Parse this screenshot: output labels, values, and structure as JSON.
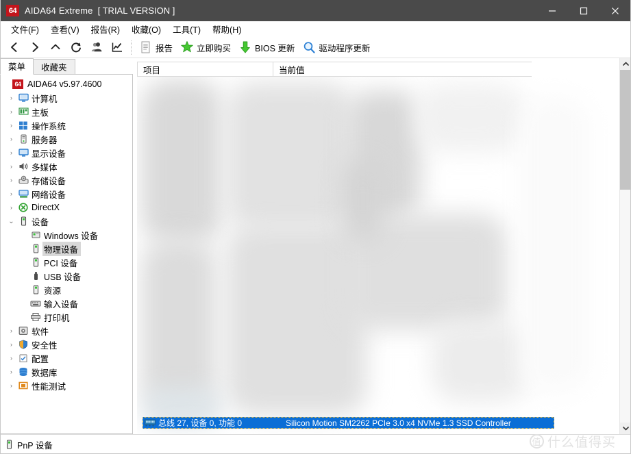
{
  "window": {
    "logo_badge": "64",
    "title": "AIDA64 Extreme",
    "trial": "[ TRIAL VERSION ]",
    "minimize_icon": "minimize-icon",
    "maximize_icon": "maximize-icon",
    "close_icon": "close-icon",
    "titlebar_color": "#4a4a4a"
  },
  "menubar": {
    "items": [
      {
        "label": "文件(F)"
      },
      {
        "label": "查看(V)"
      },
      {
        "label": "报告(R)"
      },
      {
        "label": "收藏(O)"
      },
      {
        "label": "工具(T)"
      },
      {
        "label": "帮助(H)"
      }
    ]
  },
  "toolbar": {
    "nav_icons": [
      {
        "name": "back-icon"
      },
      {
        "name": "forward-icon"
      },
      {
        "name": "up-icon"
      },
      {
        "name": "refresh-icon"
      },
      {
        "name": "user-icon"
      },
      {
        "name": "chart-icon"
      }
    ],
    "buttons": [
      {
        "icon": "report-document-icon",
        "label": "报告"
      },
      {
        "icon": "buy-now-star-icon",
        "label": "立即购买"
      },
      {
        "icon": "bios-update-download-icon",
        "label": "BIOS 更新"
      },
      {
        "icon": "driver-update-search-icon",
        "label": "驱动程序更新"
      }
    ]
  },
  "sidebar": {
    "tabs": [
      {
        "label": "菜单",
        "active": true
      },
      {
        "label": "收藏夹",
        "active": false
      }
    ],
    "root": {
      "badge": "64",
      "label": "AIDA64 v5.97.4600"
    },
    "items": [
      {
        "label": "计算机",
        "icon": "computer-icon",
        "indent": 0,
        "arrow": "collapsed",
        "selected": false
      },
      {
        "label": "主板",
        "icon": "motherboard-icon",
        "indent": 0,
        "arrow": "collapsed",
        "selected": false
      },
      {
        "label": "操作系统",
        "icon": "windows-icon",
        "indent": 0,
        "arrow": "collapsed",
        "selected": false
      },
      {
        "label": "服务器",
        "icon": "server-icon",
        "indent": 0,
        "arrow": "collapsed",
        "selected": false
      },
      {
        "label": "显示设备",
        "icon": "display-icon",
        "indent": 0,
        "arrow": "collapsed",
        "selected": false
      },
      {
        "label": "多媒体",
        "icon": "speaker-icon",
        "indent": 0,
        "arrow": "collapsed",
        "selected": false
      },
      {
        "label": "存储设备",
        "icon": "storage-icon",
        "indent": 0,
        "arrow": "collapsed",
        "selected": false
      },
      {
        "label": "网络设备",
        "icon": "network-icon",
        "indent": 0,
        "arrow": "collapsed",
        "selected": false
      },
      {
        "label": "DirectX",
        "icon": "directx-icon",
        "indent": 0,
        "arrow": "collapsed",
        "selected": false
      },
      {
        "label": "设备",
        "icon": "device-icon",
        "indent": 0,
        "arrow": "expanded",
        "selected": false
      },
      {
        "label": "Windows 设备",
        "icon": "windows-device-icon",
        "indent": 1,
        "arrow": "none",
        "selected": false
      },
      {
        "label": "物理设备",
        "icon": "device-icon",
        "indent": 1,
        "arrow": "none",
        "selected": true
      },
      {
        "label": "PCI 设备",
        "icon": "device-icon",
        "indent": 1,
        "arrow": "none",
        "selected": false
      },
      {
        "label": "USB 设备",
        "icon": "usb-icon",
        "indent": 1,
        "arrow": "none",
        "selected": false
      },
      {
        "label": "资源",
        "icon": "device-icon",
        "indent": 1,
        "arrow": "none",
        "selected": false
      },
      {
        "label": "输入设备",
        "icon": "keyboard-icon",
        "indent": 1,
        "arrow": "none",
        "selected": false
      },
      {
        "label": "打印机",
        "icon": "printer-icon",
        "indent": 1,
        "arrow": "none",
        "selected": false
      },
      {
        "label": "软件",
        "icon": "software-icon",
        "indent": 0,
        "arrow": "collapsed",
        "selected": false
      },
      {
        "label": "安全性",
        "icon": "shield-icon",
        "indent": 0,
        "arrow": "collapsed",
        "selected": false
      },
      {
        "label": "配置",
        "icon": "config-icon",
        "indent": 0,
        "arrow": "collapsed",
        "selected": false
      },
      {
        "label": "数据库",
        "icon": "database-icon",
        "indent": 0,
        "arrow": "collapsed",
        "selected": false
      },
      {
        "label": "性能测试",
        "icon": "benchmark-icon",
        "indent": 0,
        "arrow": "collapsed",
        "selected": false
      }
    ]
  },
  "main": {
    "columns": [
      {
        "label": "项目"
      },
      {
        "label": "当前值"
      }
    ],
    "selected_row": {
      "icon": "memory-chip-icon",
      "item": "总线 27, 设备 0, 功能 0",
      "value": "Silicon Motion SM2262 PCIe 3.0 x4 NVMe 1.3 SSD Controller",
      "highlight_color": "#0b6ed6"
    },
    "content_state": "blurred"
  },
  "scrollbar": {
    "up_arrow_icon": "scroll-up-icon",
    "down_arrow_icon": "scroll-down-icon",
    "thumb_top_pct": 0,
    "thumb_height_pct": 34
  },
  "statusbar": {
    "icon": "device-icon",
    "text": "PnP 设备"
  },
  "watermark": {
    "mark": "值",
    "text": "什么值得买"
  }
}
